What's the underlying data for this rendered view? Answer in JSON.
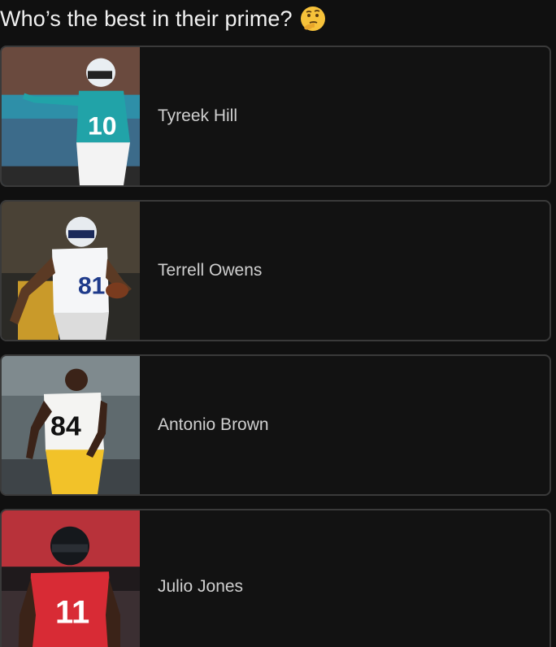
{
  "poll": {
    "question": "Who’s the best in their prime?",
    "emoji_icon": "thinking-face-icon",
    "options": [
      {
        "name": "Tyreek Hill",
        "jersey_number": "10"
      },
      {
        "name": "Terrell Owens",
        "jersey_number": "81"
      },
      {
        "name": "Antonio Brown",
        "jersey_number": "84"
      },
      {
        "name": "Julio Jones",
        "jersey_number": "11"
      }
    ]
  }
}
